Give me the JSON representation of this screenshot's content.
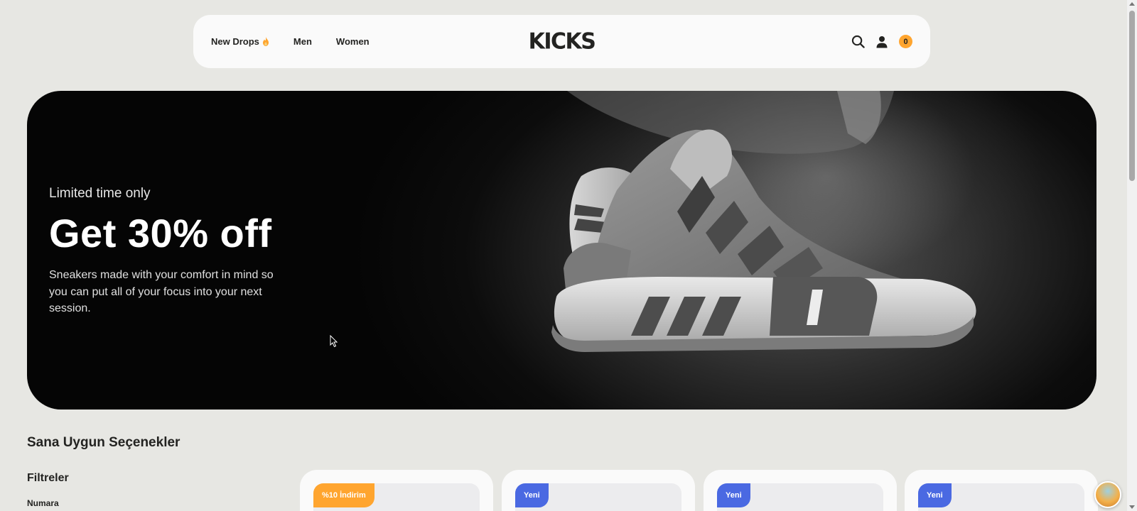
{
  "nav": {
    "links": [
      {
        "label": "New Drops"
      },
      {
        "label": "Men"
      },
      {
        "label": "Women"
      }
    ],
    "logo": "KICKS",
    "cart_count": "0",
    "accent_color": "#ffa52f"
  },
  "hero": {
    "subtitle": "Limited time only",
    "title": "Get 30% off",
    "description": "Sneakers made with your comfort in mind so you can put all of your focus into your next session."
  },
  "section": {
    "title": "Sana Uygun Seçenekler",
    "filters_title": "Filtreler",
    "filter_label": "Numara"
  },
  "products": [
    {
      "badge": "%10 İndirim",
      "badge_color": "#ffa52f"
    },
    {
      "badge": "Yeni",
      "badge_color": "#4a69e2"
    },
    {
      "badge": "Yeni",
      "badge_color": "#4a69e2"
    },
    {
      "badge": "Yeni",
      "badge_color": "#4a69e2"
    }
  ]
}
